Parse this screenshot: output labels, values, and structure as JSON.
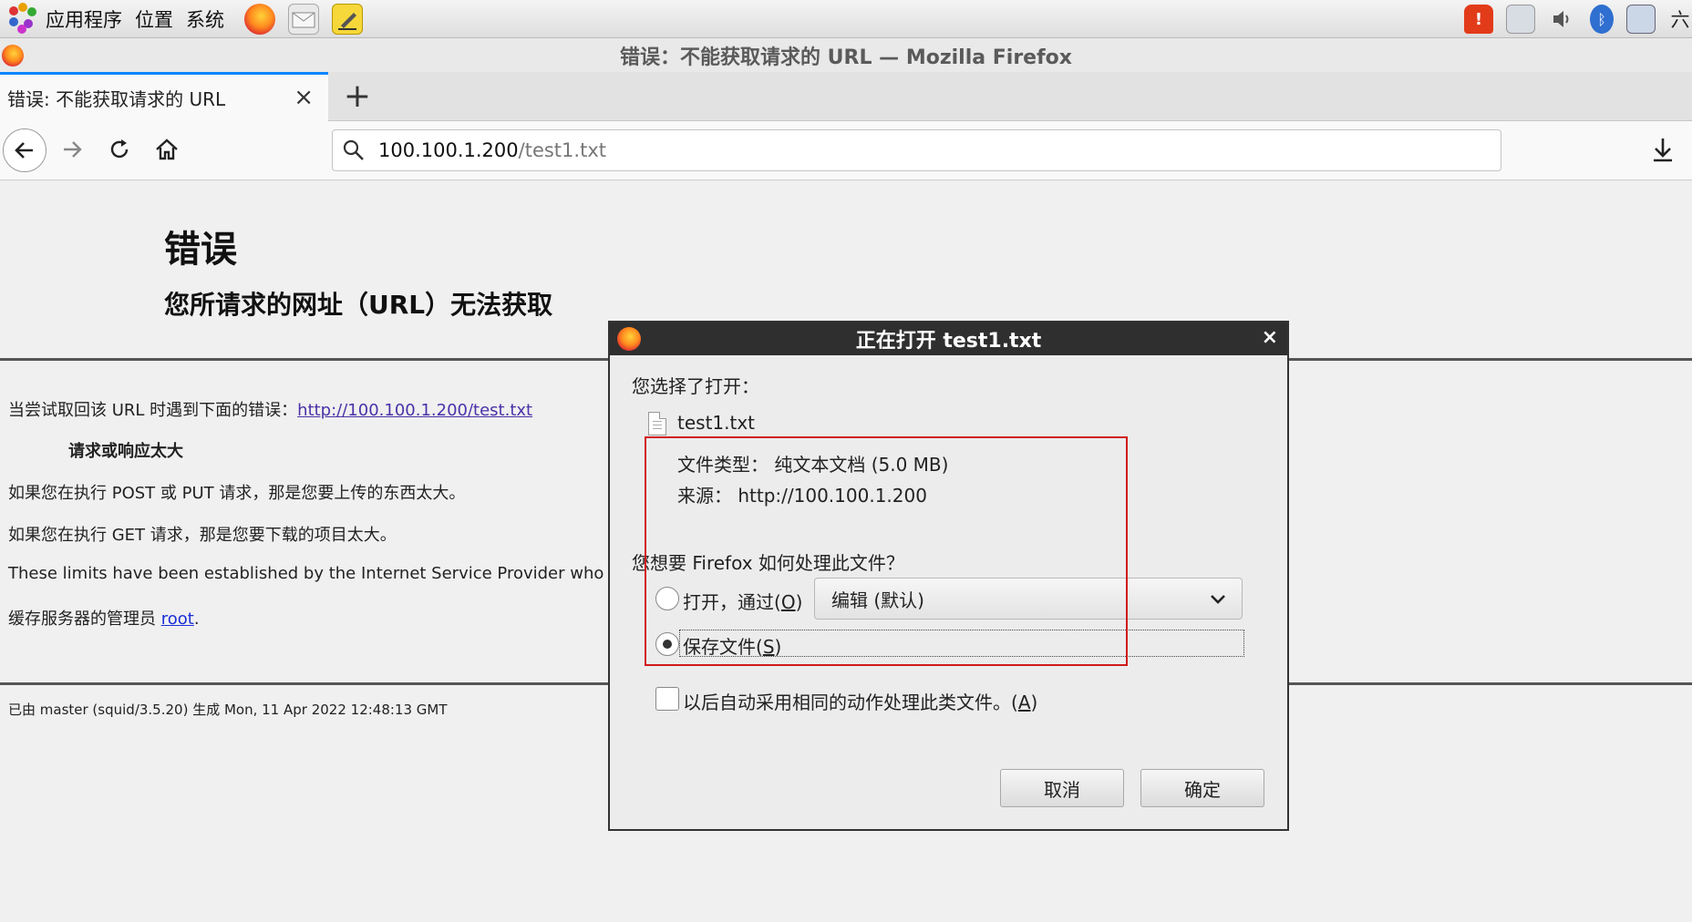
{
  "panel": {
    "menus": [
      "应用程序",
      "位置",
      "系统"
    ],
    "clock_partial": "六"
  },
  "window": {
    "title": "错误：不能获取请求的 URL — Mozilla Firefox"
  },
  "tab": {
    "label": "错误: 不能获取请求的 URL",
    "close": "×",
    "new_tab": "+"
  },
  "urlbar": {
    "host": "100.100.1.200",
    "path": "/test1.txt"
  },
  "page": {
    "heading": "错误",
    "subheading": "您所请求的网址（URL）无法获取",
    "line1_prefix": "当尝试取回该 URL 时遇到下面的错误：",
    "line1_link": "http://100.100.1.200/test.txt",
    "error_name": "请求或响应太大",
    "line2": "如果您在执行 POST 或 PUT 请求，那是您要上传的东西太大。",
    "line3": "如果您在执行 GET 请求，那是您要下载的项目太大。",
    "line4": "These limits have been established by the Internet Service Provider who oper",
    "line5_prefix": "缓存服务器的管理员 ",
    "line5_link": "root",
    "line5_suffix": ".",
    "footer": "已由 master (squid/3.5.20) 生成 Mon, 11 Apr 2022 12:48:13 GMT"
  },
  "dialog": {
    "title": "正在打开 test1.txt",
    "close": "×",
    "chosen_label": "您选择了打开：",
    "filename": "test1.txt",
    "file_type": "文件类型：  纯文本文档 (5.0 MB)",
    "source": "来源：  http://100.100.1.200",
    "question": "您想要 Firefox 如何处理此文件？",
    "open_with_label": "打开，通过(",
    "open_with_key": "O",
    "open_with_end": ")",
    "open_with_app": "编辑 (默认)",
    "save_label": "保存文件(",
    "save_key": "S",
    "save_end": ")",
    "auto_label": "以后自动采用相同的动作处理此类文件。(",
    "auto_key": "A",
    "auto_end": ")",
    "cancel": "取消",
    "ok": "确定",
    "selected_option": "save"
  }
}
